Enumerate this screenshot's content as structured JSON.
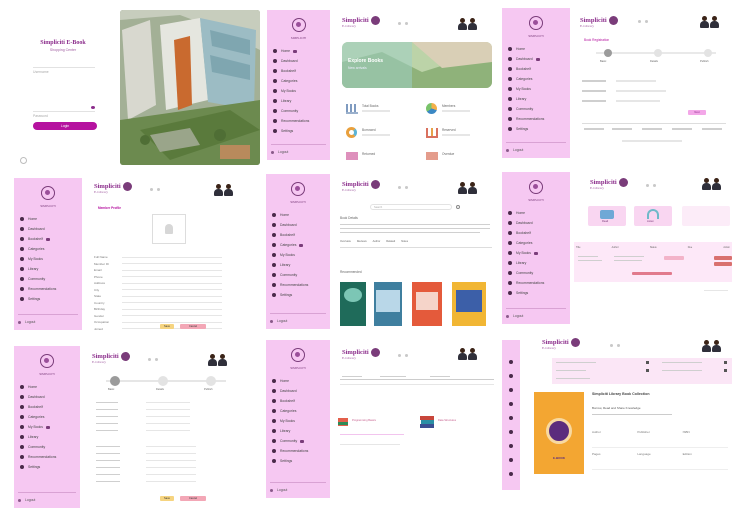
{
  "login": {
    "brand_line1": "Simpliciti",
    "brand_line2": "E-Book",
    "brand_sub": "Shopping Center",
    "field1_placeholder": "Username",
    "field2_placeholder": "Password",
    "button_label": "Login"
  },
  "brand": {
    "name": "Simpliciti",
    "sub": "E-Library"
  },
  "sidebar": {
    "tagline": "SIMPLICITI",
    "items": [
      "Home",
      "Dashboard",
      "Bookshelf",
      "Categories",
      "My Books",
      "Library",
      "Community",
      "Recommendations",
      "Settings"
    ],
    "logout": "Logout"
  },
  "dashboard": {
    "banner_title": "Explore Books",
    "banner_sub": "New arrivals",
    "stats": [
      "Total Books",
      "Members",
      "Borrowed",
      "Reserved",
      "Returned",
      "Overdue"
    ]
  },
  "stepper": {
    "title": "Book Registration",
    "steps": [
      "Basic",
      "Details",
      "Publish"
    ],
    "action": "Next"
  },
  "profile": {
    "title": "Member Profile",
    "fields": [
      "Full Name",
      "Member ID",
      "Email",
      "Phone",
      "Address",
      "City",
      "State",
      "Country",
      "Birthday",
      "Gender",
      "Occupation",
      "Joined"
    ],
    "save": "Save",
    "cancel": "Cancel"
  },
  "search": {
    "placeholder": "Search",
    "section1": "Book Details",
    "section2": "Recommended",
    "tabs": [
      "Overview",
      "Reviews",
      "Author",
      "Related",
      "Notes"
    ]
  },
  "cards": {
    "card1": "Read",
    "card2": "Listen",
    "table_headers": [
      "Title",
      "Author",
      "Status",
      "Due",
      "Action"
    ]
  },
  "list": {
    "book1": "Programming Basics",
    "book2": "Data Structures"
  },
  "book": {
    "title": "Simpliciti Library Book Collection",
    "subtitle": "Borrow, Read and Share Knowledge",
    "badge": "E-BOOK",
    "fields": [
      "Author",
      "Publisher",
      "ISBN",
      "Pages",
      "Language",
      "Edition"
    ]
  },
  "colors": {
    "sidebar": "#f6c8f2",
    "accent": "#b5129f",
    "brand": "#8b2c8b"
  }
}
